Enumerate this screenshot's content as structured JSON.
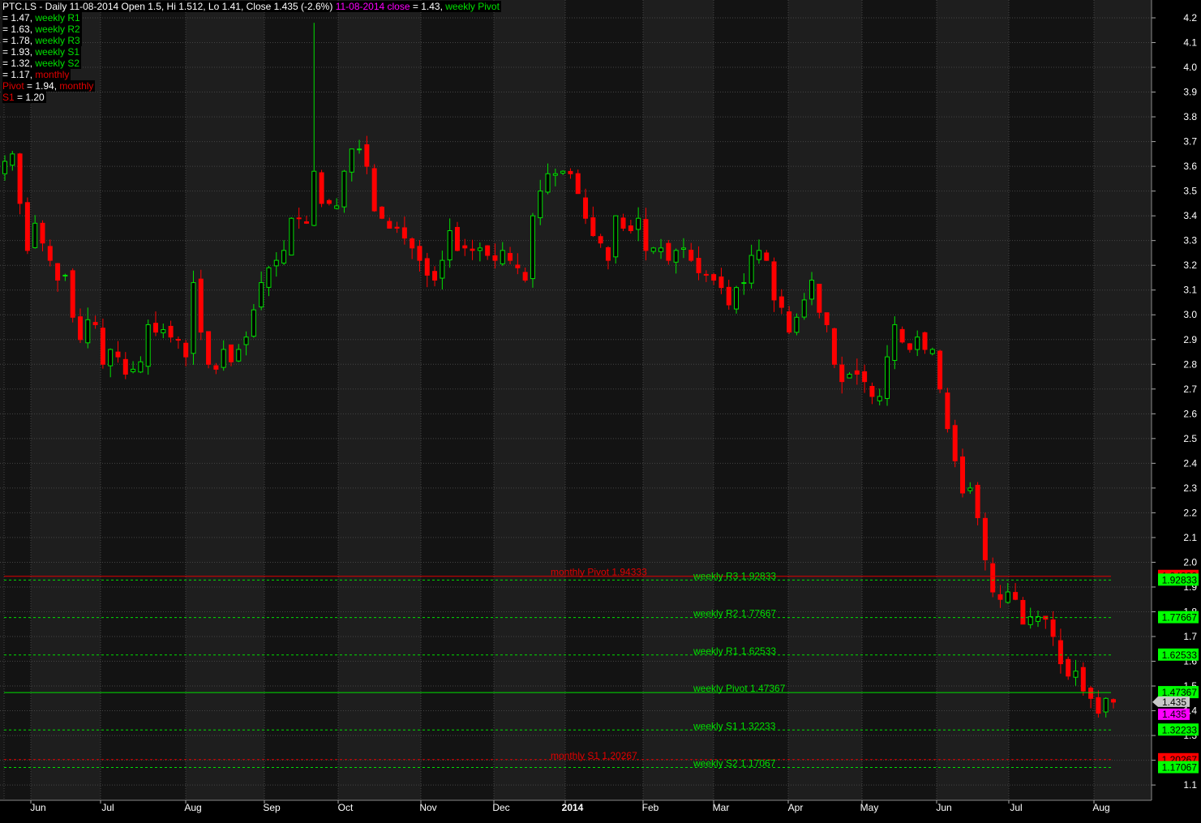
{
  "header": {
    "symbol": "PTC.LS - Daily 11-08-2014 Open 1.5, Hi 1.512, Lo 1.41, Close 1.435 (-2.6%)",
    "close_label": "11-08-2014 close",
    "close_value": " = 1.43, ",
    "weekly_pivot_label": "weekly Pivot"
  },
  "legend": [
    {
      "value": " = 1.47, ",
      "label": "weekly R1",
      "color": "g"
    },
    {
      "value": " = 1.63, ",
      "label": "weekly R2",
      "color": "g"
    },
    {
      "value": " = 1.78, ",
      "label": "weekly R3",
      "color": "g"
    },
    {
      "value": " = 1.93, ",
      "label": "weekly S1",
      "color": "g"
    },
    {
      "value": " = 1.32, ",
      "label": "weekly S2",
      "color": "g"
    },
    {
      "value": " = 1.17, ",
      "label": "monthly",
      "color": "r"
    },
    {
      "prefix": "Pivot",
      "value": " = 1.94, ",
      "label": "monthly",
      "color": "r"
    },
    {
      "prefix": "S1",
      "value": " = 1.20",
      "label": "",
      "color": "r"
    }
  ],
  "chart_data": {
    "type": "candlestick",
    "title": "PTC.LS - Daily",
    "ylim": [
      1.1,
      4.2
    ],
    "yticks": [
      1.1,
      1.2,
      1.3,
      1.4,
      1.5,
      1.6,
      1.7,
      1.8,
      1.9,
      2.0,
      2.1,
      2.2,
      2.3,
      2.4,
      2.5,
      2.6,
      2.7,
      2.8,
      2.9,
      3.0,
      3.1,
      3.2,
      3.3,
      3.4,
      3.5,
      3.6,
      3.7,
      3.8,
      3.9,
      4.0,
      4.1,
      4.2
    ],
    "xticks": [
      "Jun",
      "Jul",
      "Aug",
      "Sep",
      "Oct",
      "Nov",
      "Dec",
      "2014",
      "Feb",
      "Mar",
      "Apr",
      "May",
      "Jun",
      "Jul",
      "Aug"
    ],
    "closes": [
      3.62,
      3.65,
      3.45,
      3.26,
      3.37,
      3.29,
      3.22,
      3.14,
      3.16,
      2.99,
      2.9,
      2.98,
      2.96,
      2.8,
      2.86,
      2.83,
      2.76,
      2.78,
      2.81,
      2.96,
      2.93,
      2.94,
      2.91,
      2.9,
      2.83,
      3.13,
      2.93,
      2.8,
      2.78,
      2.86,
      2.81,
      2.86,
      2.91,
      3.02,
      3.13,
      3.19,
      3.22,
      3.26,
      3.39,
      3.39,
      3.37,
      3.58,
      3.45,
      3.45,
      3.44,
      3.58,
      3.67,
      3.67,
      3.6,
      3.42,
      3.39,
      3.35,
      3.35,
      3.31,
      3.27,
      3.22,
      3.16,
      3.14,
      3.22,
      3.34,
      3.26,
      3.27,
      3.26,
      3.27,
      3.24,
      3.22,
      3.26,
      3.22,
      3.19,
      3.14,
      3.4,
      3.5,
      3.57,
      3.57,
      3.58,
      3.57,
      3.49,
      3.39,
      3.32,
      3.29,
      3.22,
      3.4,
      3.35,
      3.34,
      3.39,
      3.26,
      3.27,
      3.27,
      3.22,
      3.26,
      3.27,
      3.22,
      3.17,
      3.16,
      3.14,
      3.11,
      3.04,
      3.11,
      3.13,
      3.24,
      3.26,
      3.22,
      3.06,
      3.03,
      2.93,
      2.99,
      3.06,
      3.14,
      3.01,
      2.96,
      2.8,
      2.73,
      2.76,
      2.76,
      2.73,
      2.67,
      2.67,
      2.83,
      2.96,
      2.89,
      2.86,
      2.91,
      2.86,
      2.86,
      2.7,
      2.54,
      2.41,
      2.28,
      2.3,
      2.18,
      2.01,
      1.88,
      1.85,
      1.88,
      1.85,
      1.75,
      1.78,
      1.78,
      1.77,
      1.7,
      1.59,
      1.54,
      1.56,
      1.48,
      1.45,
      1.39,
      1.45,
      1.435
    ],
    "spike_high": {
      "month": "Oct",
      "value": 4.18
    },
    "levels": [
      {
        "name": "monthly Pivot",
        "value": 1.94333,
        "label": "monthly Pivot  1.94333",
        "tag": "1.94333",
        "color": "#e00000",
        "style": "solid",
        "labelpos": "monthly"
      },
      {
        "name": "weekly R3",
        "value": 1.92833,
        "label": "weekly R3 1.92833",
        "tag": "1.92833",
        "color": "#00e000",
        "style": "dashed",
        "labelpos": "weekly"
      },
      {
        "name": "weekly R2",
        "value": 1.77667,
        "label": "weekly R2 1.77667",
        "tag": "1.77667",
        "color": "#00e000",
        "style": "dashed",
        "labelpos": "weekly"
      },
      {
        "name": "weekly R1",
        "value": 1.62533,
        "label": "weekly R1  1.62533",
        "tag": "1.62533",
        "color": "#00e000",
        "style": "dashed",
        "labelpos": "weekly"
      },
      {
        "name": "weekly Pivot",
        "value": 1.47367,
        "label": "weekly Pivot  1.47367",
        "tag": "1.47367",
        "color": "#00e000",
        "style": "solid",
        "labelpos": "weekly"
      },
      {
        "name": "weekly S1",
        "value": 1.32233,
        "label": "weekly S1 1.32233",
        "tag": "1.32233",
        "color": "#00e000",
        "style": "dashed",
        "labelpos": "weekly"
      },
      {
        "name": "monthly S1",
        "value": 1.20267,
        "label": "monthly S1 1.20267",
        "tag": "1.20267",
        "color": "#e00000",
        "style": "dashed",
        "labelpos": "monthly"
      },
      {
        "name": "weekly S2",
        "value": 1.17067,
        "label": "weekly S2 1.17067",
        "tag": "1.17067",
        "color": "#00e000",
        "style": "dashed",
        "labelpos": "weekly"
      }
    ],
    "last_price": {
      "value": 1.435,
      "tag": "1.435",
      "close_tag": "1.435"
    }
  }
}
